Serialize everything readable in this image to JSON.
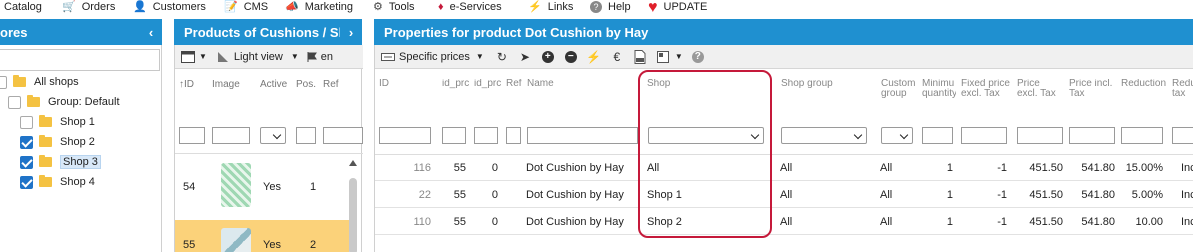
{
  "menu": [
    {
      "label": "Catalog",
      "icon": "catalog-icon",
      "glyph": ""
    },
    {
      "label": "Orders",
      "icon": "cart-icon",
      "glyph": "🛒"
    },
    {
      "label": "Customers",
      "icon": "user-icon",
      "glyph": "👤"
    },
    {
      "label": "CMS",
      "icon": "edit-icon",
      "glyph": "📝"
    },
    {
      "label": "Marketing",
      "icon": "megaphone-icon",
      "glyph": "📣"
    },
    {
      "label": "Tools",
      "icon": "gear-icon",
      "glyph": "⚙"
    },
    {
      "label": "e-Services",
      "icon": "diamond-icon",
      "glyph": "♦"
    },
    {
      "label": "Links",
      "icon": "lightning-icon",
      "glyph": "⚡"
    },
    {
      "label": "Help",
      "icon": "question-icon",
      "glyph": "?"
    },
    {
      "label": "UPDATE",
      "icon": "heart-icon",
      "glyph": "♥"
    }
  ],
  "colors": {
    "header_bg": "#1f90d0",
    "highlight": "#c5193a",
    "check": "#1f73c8",
    "folder": "#f4c242",
    "row_selected": "#fbd27a"
  },
  "stores": {
    "title": "ores",
    "chevron": "‹",
    "tree": [
      {
        "label": "All shops",
        "checked": null
      },
      {
        "label": "Group: Default",
        "checked": false
      },
      {
        "label": "Shop 1",
        "checked": false
      },
      {
        "label": "Shop 2",
        "checked": true
      },
      {
        "label": "Shop 3",
        "checked": true,
        "selected": true
      },
      {
        "label": "Shop 4",
        "checked": true
      }
    ]
  },
  "products": {
    "title": "Products of Cushions / Sh",
    "chevron": "›",
    "toolbar": {
      "light_view": "Light view",
      "lang": "en"
    },
    "columns": [
      "ID",
      "Image",
      "Active",
      "Pos.",
      "Ref"
    ],
    "rows": [
      {
        "id": "54",
        "active": "Yes",
        "pos": "1"
      },
      {
        "id": "55",
        "active": "Yes",
        "pos": "2"
      }
    ]
  },
  "properties": {
    "title": "Properties for product Dot Cushion by Hay",
    "toolbar": {
      "specific_prices": "Specific prices"
    },
    "columns": {
      "id": "ID",
      "id_product": "id_prc",
      "id_product_attribute": "id_prc",
      "ref": "Ref",
      "name": "Name",
      "shop": "Shop",
      "shop_group": "Shop group",
      "customer_group": "Custom group",
      "min_qty": "Minimu quantity",
      "fixed_price": "Fixed price excl. Tax",
      "price_excl": "Price excl. Tax",
      "price_incl": "Price incl. Tax",
      "reduction": "Reduction",
      "reduction_tax": "Redu tax"
    },
    "rows": [
      {
        "id": "116",
        "id_product": "55",
        "id_attr": "0",
        "name": "Dot Cushion by Hay",
        "shop": "All",
        "shop_group": "All",
        "customer_group": "All",
        "min_qty": "1",
        "fixed": "-1",
        "price_excl": "451.50",
        "price_incl": "541.80",
        "reduction": "15.00%",
        "red_tax": "Inc"
      },
      {
        "id": "22",
        "id_product": "55",
        "id_attr": "0",
        "name": "Dot Cushion by Hay",
        "shop": "Shop 1",
        "shop_group": "All",
        "customer_group": "All",
        "min_qty": "1",
        "fixed": "-1",
        "price_excl": "451.50",
        "price_incl": "541.80",
        "reduction": "5.00%",
        "red_tax": "Inc"
      },
      {
        "id": "110",
        "id_product": "55",
        "id_attr": "0",
        "name": "Dot Cushion by Hay",
        "shop": "Shop 2",
        "shop_group": "All",
        "customer_group": "All",
        "min_qty": "1",
        "fixed": "-1",
        "price_excl": "451.50",
        "price_incl": "541.80",
        "reduction": "10.00",
        "red_tax": "Inc"
      }
    ]
  }
}
